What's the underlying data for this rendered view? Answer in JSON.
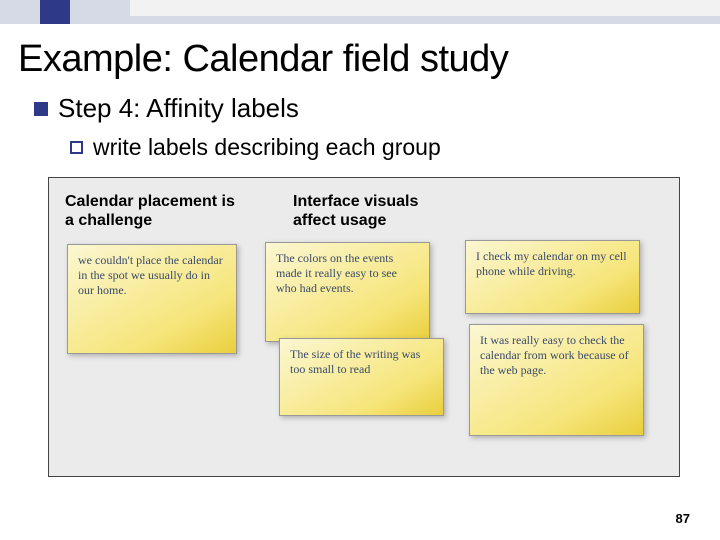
{
  "title": "Example: Calendar field study",
  "bullet1": "Step 4: Affinity labels",
  "bullet2": "write labels describing each group",
  "labels": {
    "l1": "Calendar placement is a challenge",
    "l2": "Interface visuals affect usage"
  },
  "notes": {
    "n1": "we couldn't place the calendar in the spot we usually do in our home.",
    "n2": "The colors on the events made it really easy to see who had events.",
    "n3": "The size of the writing was too small to read",
    "n4": "I check my calendar on my cell phone while driving.",
    "n5": "It was really easy to check the calendar from work because of the web page."
  },
  "page": "87"
}
